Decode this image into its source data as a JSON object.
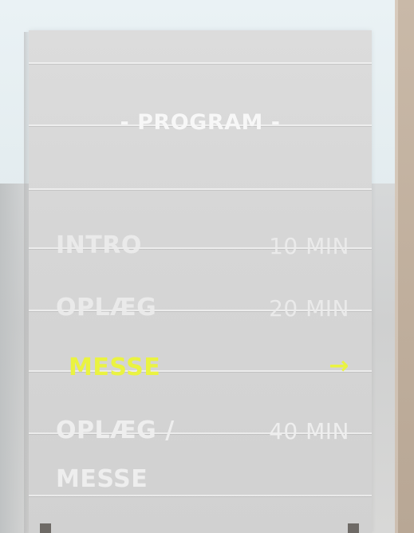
{
  "program": {
    "title": "- PROGRAM -",
    "items": [
      {
        "label": "INTRO",
        "time": "10 MIN"
      },
      {
        "label": "OPLÆG",
        "time": "20 MIN"
      },
      {
        "label": "MESSE",
        "icon": "arrow-right-icon",
        "state": "active"
      },
      {
        "label_line1": "OPLÆG /",
        "label_line2": "MESSE",
        "time": "40 MIN"
      }
    ]
  },
  "colors": {
    "active_accent": "#eaf341",
    "text": "#eeeeee",
    "board": "#d8d8d8"
  }
}
